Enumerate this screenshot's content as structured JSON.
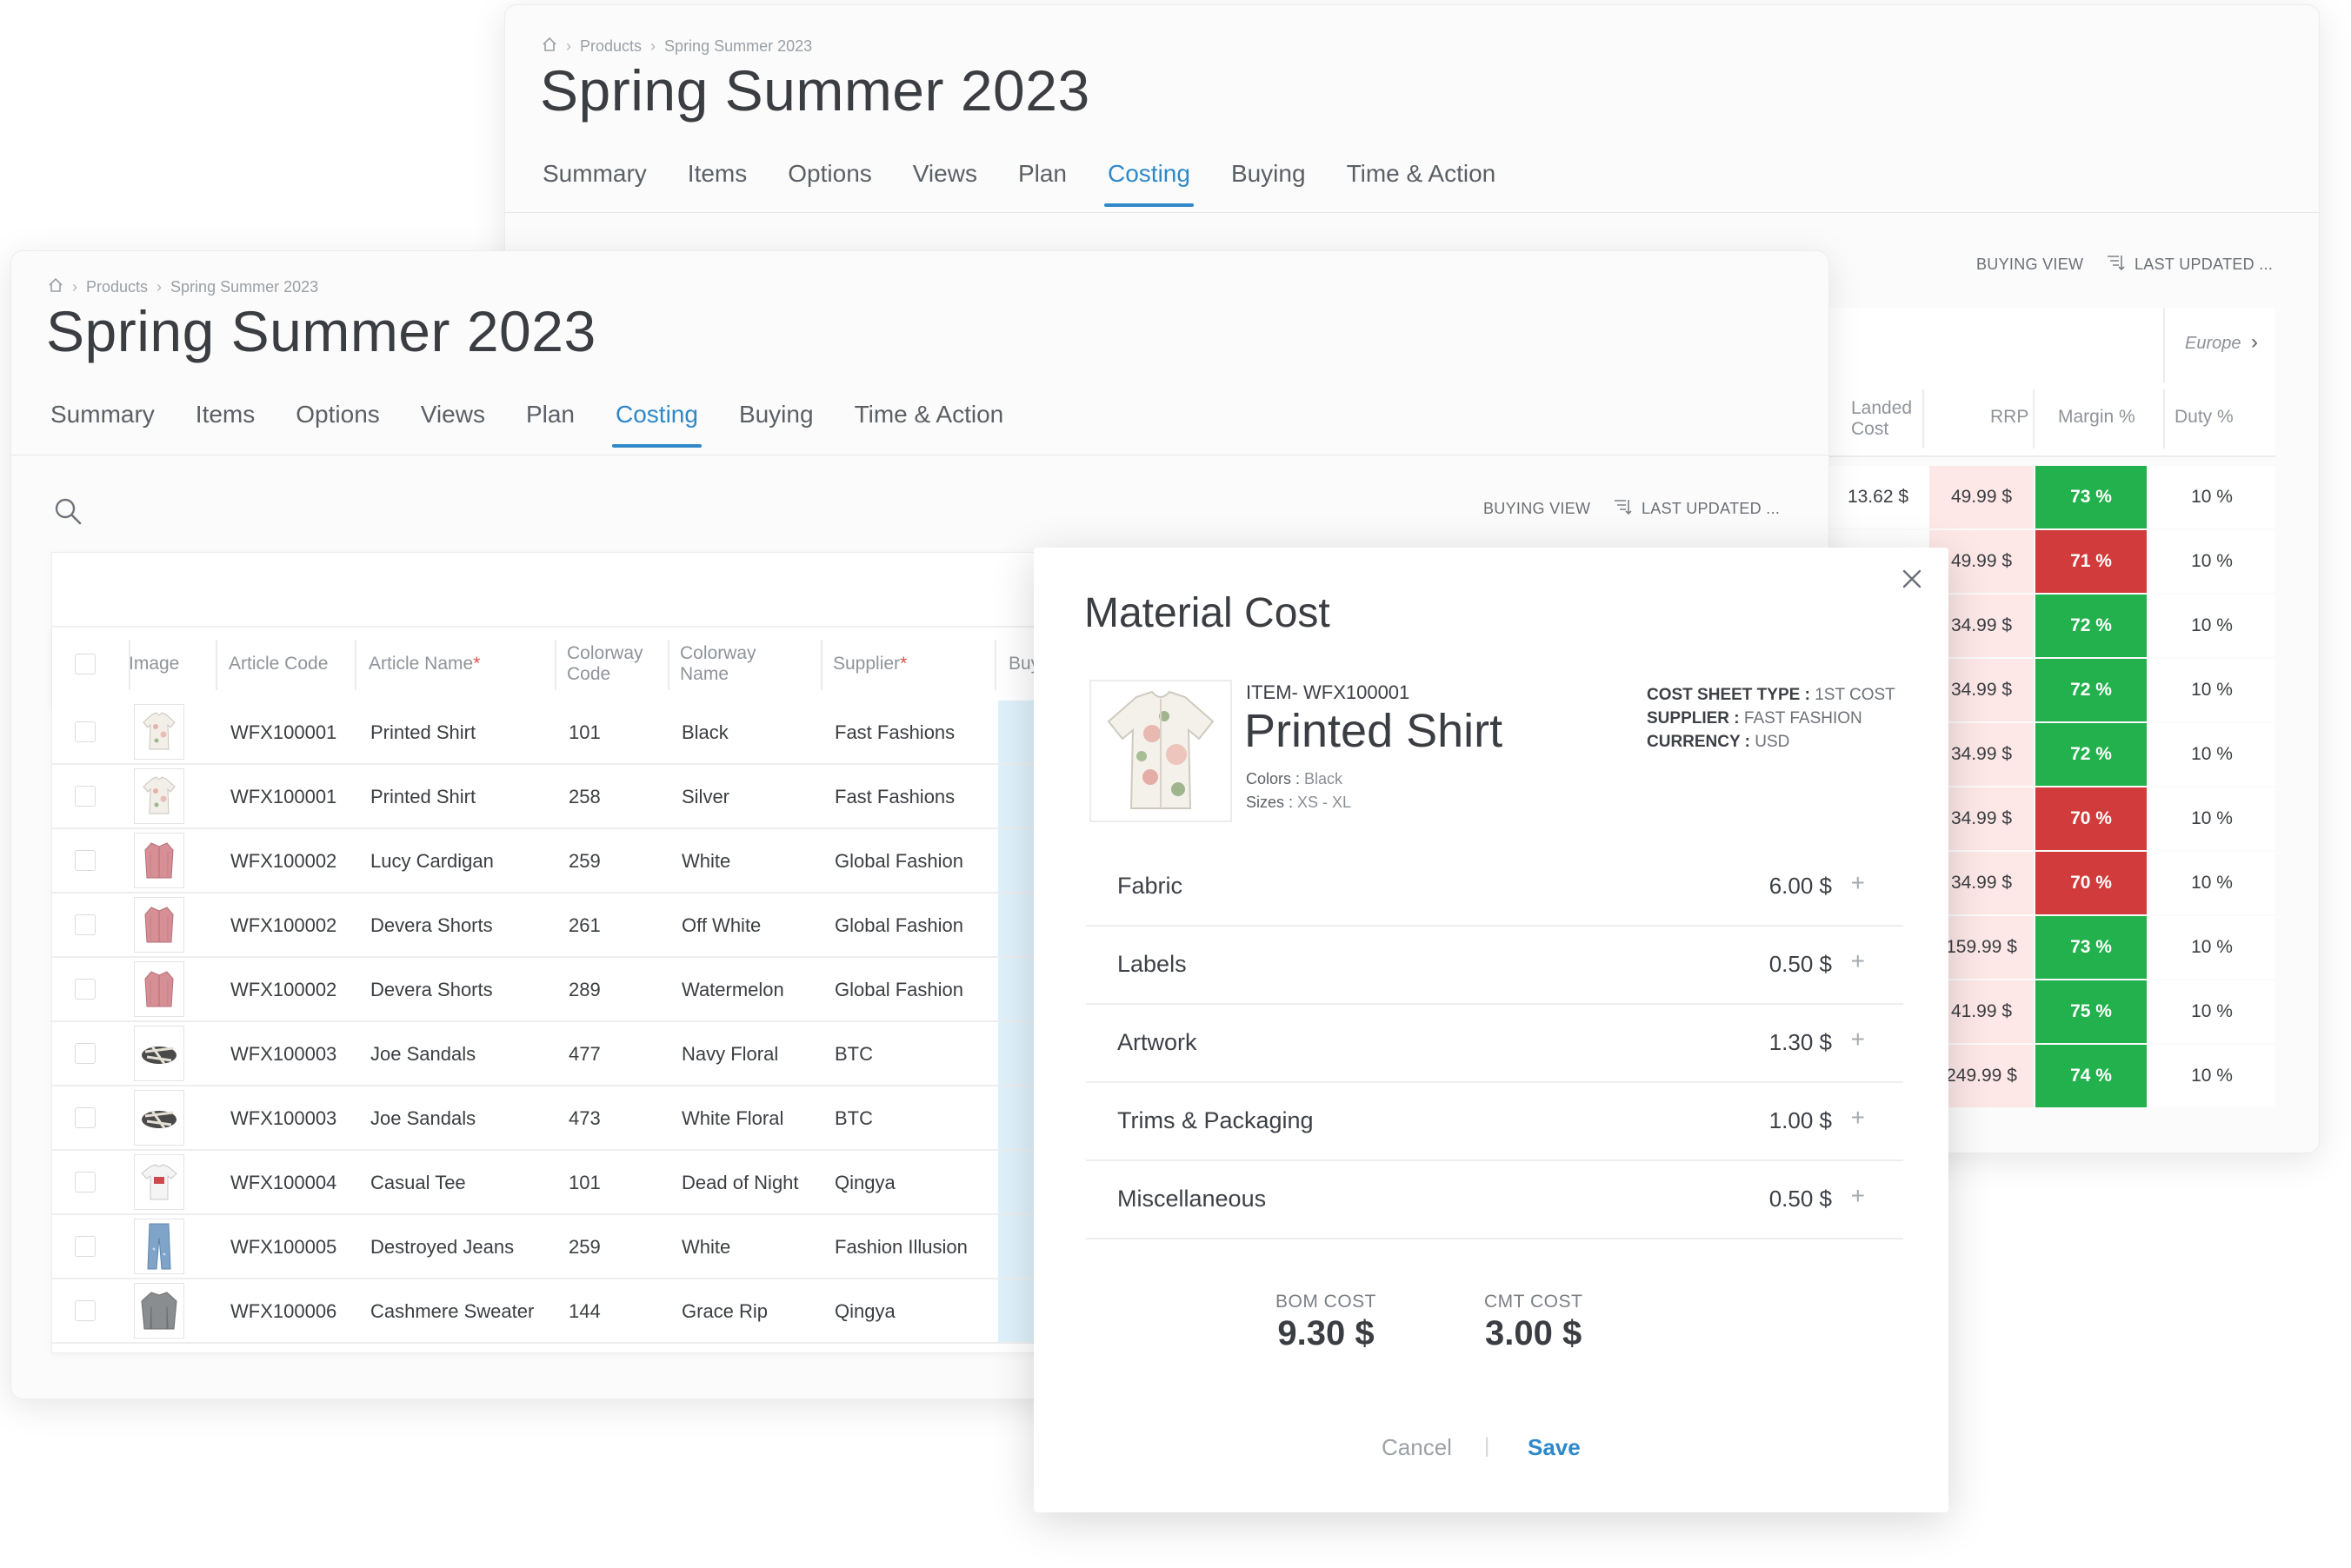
{
  "app": {
    "breadcrumb": [
      "Products",
      "Spring Summer 2023"
    ],
    "title": "Spring Summer 2023",
    "tabs": [
      "Summary",
      "Items",
      "Options",
      "Views",
      "Plan",
      "Costing",
      "Buying",
      "Time & Action"
    ],
    "active_tab": "Costing"
  },
  "toolbar": {
    "buying_view": "BUYING VIEW",
    "last_updated": "LAST UPDATED ..."
  },
  "table": {
    "headers": {
      "image": "Image",
      "article_code": "Article Code",
      "article_name": "Article Name",
      "colorway_code": "Colorway Code",
      "colorway_name": "Colorway Name",
      "supplier": "Supplier",
      "buying": "Buyi",
      "required_mark": "*"
    },
    "rows": [
      {
        "thumb": "shirt-icon",
        "code": "WFX100001",
        "name": "Printed Shirt",
        "cw_code": "101",
        "cw_name": "Black",
        "supplier": "Fast Fashions"
      },
      {
        "thumb": "shirt-icon",
        "code": "WFX100001",
        "name": "Printed Shirt",
        "cw_code": "258",
        "cw_name": "Silver",
        "supplier": "Fast Fashions"
      },
      {
        "thumb": "cardigan-icon",
        "code": "WFX100002",
        "name": "Lucy Cardigan",
        "cw_code": "259",
        "cw_name": "White",
        "supplier": "Global Fashion"
      },
      {
        "thumb": "cardigan-icon",
        "code": "WFX100002",
        "name": "Devera Shorts",
        "cw_code": "261",
        "cw_name": "Off White",
        "supplier": "Global Fashion"
      },
      {
        "thumb": "cardigan-icon",
        "code": "WFX100002",
        "name": "Devera Shorts",
        "cw_code": "289",
        "cw_name": "Watermelon",
        "supplier": "Global Fashion"
      },
      {
        "thumb": "sandal-icon",
        "code": "WFX100003",
        "name": "Joe Sandals",
        "cw_code": "477",
        "cw_name": "Navy Floral",
        "supplier": "BTC"
      },
      {
        "thumb": "sandal-icon",
        "code": "WFX100003",
        "name": "Joe Sandals",
        "cw_code": "473",
        "cw_name": "White Floral",
        "supplier": "BTC"
      },
      {
        "thumb": "tee-icon",
        "code": "WFX100004",
        "name": "Casual Tee",
        "cw_code": "101",
        "cw_name": "Dead of Night",
        "supplier": "Qingya"
      },
      {
        "thumb": "jeans-icon",
        "code": "WFX100005",
        "name": "Destroyed Jeans",
        "cw_code": "259",
        "cw_name": "White",
        "supplier": "Fashion Illusion"
      },
      {
        "thumb": "sweater-icon",
        "code": "WFX100006",
        "name": "Cashmere Sweater",
        "cw_code": "144",
        "cw_name": "Grace Rip",
        "supplier": "Qingya"
      }
    ]
  },
  "back_table": {
    "region": "Europe",
    "headers": {
      "landed_cost": "Landed Cost",
      "rrp": "RRP",
      "margin": "Margin %",
      "duty": "Duty %"
    },
    "rows": [
      {
        "landed": "13.62 $",
        "rrp": "49.99 $",
        "margin": "73 %",
        "margin_status": "good",
        "duty": "10 %"
      },
      {
        "landed": "",
        "rrp": "49.99 $",
        "margin": "71 %",
        "margin_status": "bad",
        "duty": "10 %"
      },
      {
        "landed": "",
        "rrp": "34.99 $",
        "margin": "72 %",
        "margin_status": "good",
        "duty": "10 %"
      },
      {
        "landed": "",
        "rrp": "34.99 $",
        "margin": "72 %",
        "margin_status": "good",
        "duty": "10 %"
      },
      {
        "landed": "",
        "rrp": "34.99 $",
        "margin": "72 %",
        "margin_status": "good",
        "duty": "10 %"
      },
      {
        "landed": "",
        "rrp": "34.99 $",
        "margin": "70 %",
        "margin_status": "bad",
        "duty": "10 %"
      },
      {
        "landed": "",
        "rrp": "34.99 $",
        "margin": "70 %",
        "margin_status": "bad",
        "duty": "10 %"
      },
      {
        "landed": "",
        "rrp": "159.99 $",
        "margin": "73 %",
        "margin_status": "good",
        "duty": "10 %"
      },
      {
        "landed": "",
        "rrp": "41.99 $",
        "margin": "75 %",
        "margin_status": "good",
        "duty": "10 %"
      },
      {
        "landed": "",
        "rrp": "249.99 $",
        "margin": "74 %",
        "margin_status": "good",
        "duty": "10 %"
      }
    ],
    "colors": {
      "good": "#22b14c",
      "bad": "#d23b3b",
      "rrp_bg": "#fde7e7"
    }
  },
  "modal": {
    "title": "Material Cost",
    "item_code": "ITEM- WFX100001",
    "item_name": "Printed Shirt",
    "colors_label": "Colors :",
    "colors_value": "Black",
    "sizes_label": "Sizes :",
    "sizes_value": "XS - XL",
    "cost_sheet_type_label": "COST SHEET TYPE :",
    "cost_sheet_type_value": "1ST COST",
    "supplier_label": "SUPPLIER :",
    "supplier_value": "FAST FASHION",
    "currency_label": "CURRENCY :",
    "currency_value": "USD",
    "lines": [
      {
        "label": "Fabric",
        "value": "6.00 $"
      },
      {
        "label": "Labels",
        "value": "0.50 $"
      },
      {
        "label": "Artwork",
        "value": "1.30 $"
      },
      {
        "label": "Trims & Packaging",
        "value": "1.00 $"
      },
      {
        "label": "Miscellaneous",
        "value": "0.50 $"
      }
    ],
    "bom_label": "BOM COST",
    "bom_value": "9.30 $",
    "cmt_label": "CMT COST",
    "cmt_value": "3.00 $",
    "cancel": "Cancel",
    "save": "Save",
    "divider": "|"
  },
  "theme": {
    "accent": "#2f88c8"
  }
}
